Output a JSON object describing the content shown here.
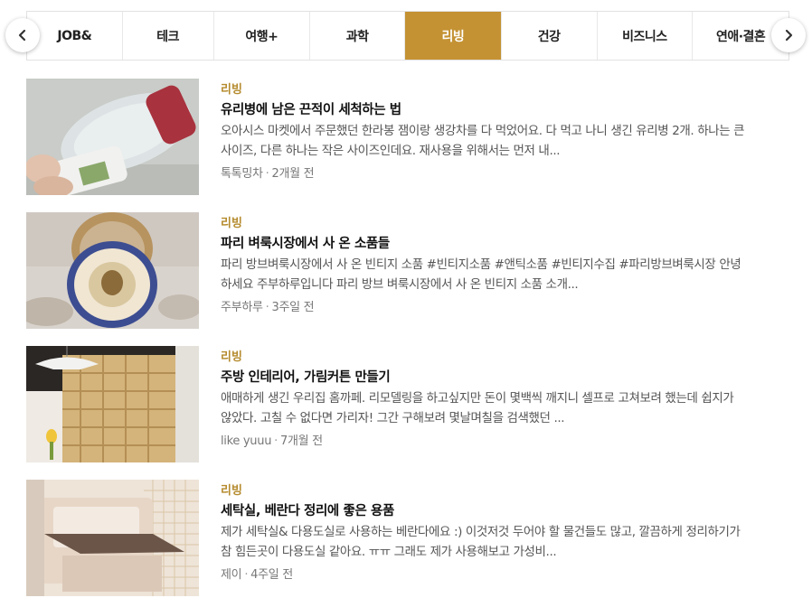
{
  "tabs": [
    {
      "label": "JOB&",
      "active": false
    },
    {
      "label": "테크",
      "active": false
    },
    {
      "label": "여행+",
      "active": false
    },
    {
      "label": "과학",
      "active": false
    },
    {
      "label": "리빙",
      "active": true
    },
    {
      "label": "건강",
      "active": false
    },
    {
      "label": "비즈니스",
      "active": false
    },
    {
      "label": "연애·결혼",
      "active": false
    }
  ],
  "nav": {
    "prev_icon": "chevron-left-icon",
    "next_icon": "chevron-right-icon"
  },
  "colors": {
    "accent": "#c49233",
    "category_text": "#b58b2e"
  },
  "articles": [
    {
      "category": "리빙",
      "title": "유리병에 남은 끈적이 세척하는 법",
      "description": "오아시스 마켓에서 주문했던 한라봉 잼이랑 생강차를 다 먹었어요. 다 먹고 나니 생긴 유리병 2개. 하나는 큰 사이즈, 다른 하나는 작은 사이즈인데요. 재사용을 위해서는 먼저 내...",
      "author": "톡톡밍차",
      "time": "2개월 전"
    },
    {
      "category": "리빙",
      "title": "파리 벼룩시장에서 사 온 소품들",
      "description": "파리 방브벼룩시장에서 사 온 빈티지 소품 #빈티지소품 #앤틱소품 #빈티지수집 #파리방브벼룩시장 안녕하세요 주부하루입니다 파리 방브 벼룩시장에서 사 온 빈티지 소품 소개...",
      "author": "주부하루",
      "time": "3주일 전"
    },
    {
      "category": "리빙",
      "title": "주방 인테리어, 가림커튼 만들기",
      "description": "애매하게 생긴 우리집 홈까페. 리모델링을 하고싶지만 돈이 몇백씩 깨지니 셀프로 고쳐보려 했는데 쉽지가 않았다. 고칠 수 없다면 가리자! 그간 구해보려 몇날며칠을 검색했던 ...",
      "author": "like yuuu",
      "time": "7개월 전"
    },
    {
      "category": "리빙",
      "title": "세탁실, 베란다 정리에 좋은 용품",
      "description": "제가 세탁실& 다용도실로 사용하는 베란다에요 :) 이것저것 두어야 할 물건들도 많고, 깔끔하게 정리하기가 참 힘든곳이 다용도실 같아요. ㅠㅠ 그래도 제가 사용해보고 가성비...",
      "author": "제이",
      "time": "4주일 전"
    }
  ]
}
